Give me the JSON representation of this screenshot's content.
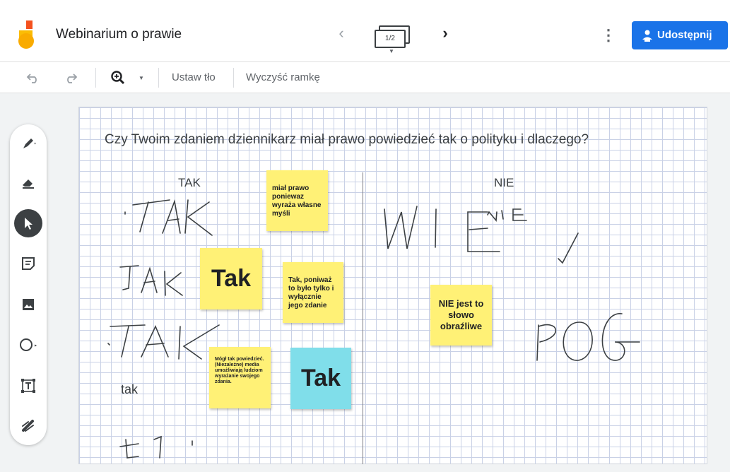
{
  "header": {
    "title": "Webinarium o prawie",
    "frame_counter": "1/2",
    "share_label": "Udostępnij",
    "icons": {
      "logo": "jamboard-logo",
      "prev": "chevron-left-icon",
      "next": "chevron-right-icon",
      "more": "more-vert-icon",
      "share": "person-share-icon"
    }
  },
  "toolbar": {
    "set_background_label": "Ustaw tło",
    "clear_frame_label": "Wyczyść ramkę",
    "icons": [
      "undo-icon",
      "redo-icon",
      "zoom-icon",
      "dropdown-icon"
    ]
  },
  "canvas": {
    "question": "Czy Twoim zdaniem dziennikarz miał prawo powiedzieć tak o polityku i dlaczego?",
    "column_tak": "TAK",
    "column_nie": "NIE",
    "typed_text": "tak",
    "stickies": [
      {
        "text": "miał prawo poniewaz wyraża własne myśli",
        "color": "#fff176"
      },
      {
        "text": "Tak",
        "color": "#fff176"
      },
      {
        "text": "Tak, poniważ to było tylko i wyłącznie jego zdanie",
        "color": "#fff176"
      },
      {
        "text": "Mógł tak powiedzieć. (Niezależne) media umożliwiają ludziom wyrażanie swojego zdania.",
        "color": "#fff176"
      },
      {
        "text": "Tak",
        "color": "#80deea"
      },
      {
        "text": "NIE jest to słowo obraźliwe",
        "color": "#fff176"
      }
    ]
  },
  "tools": [
    "pen-icon",
    "eraser-icon",
    "select-icon",
    "sticky-note-icon",
    "image-icon",
    "circle-icon",
    "text-box-icon",
    "laser-icon"
  ],
  "colors": {
    "accent": "#1a73e8",
    "sticky_yellow": "#fff176",
    "sticky_cyan": "#80deea"
  }
}
